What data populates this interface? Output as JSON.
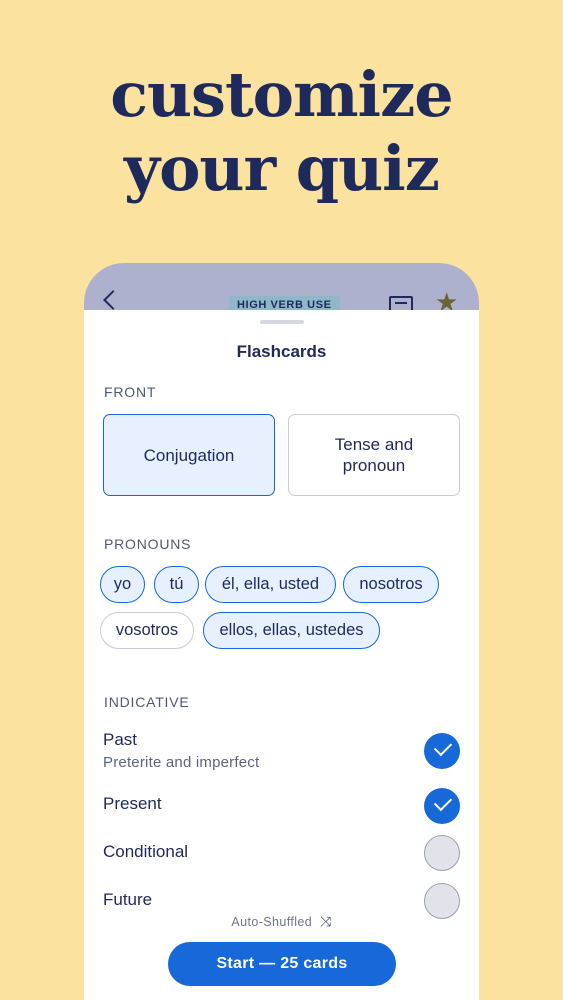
{
  "headline": {
    "line1": "customize",
    "line2": "your quiz"
  },
  "topbar": {
    "tag": "HIGH VERB USE",
    "star_glyph": "★"
  },
  "sheet": {
    "title": "Flashcards",
    "front": {
      "label": "FRONT",
      "options": [
        {
          "label": "Conjugation",
          "selected": true
        },
        {
          "label": "Tense and pronoun",
          "selected": false
        }
      ]
    },
    "pronouns": {
      "label": "PRONOUNS",
      "chips": [
        {
          "label": "yo",
          "selected": true
        },
        {
          "label": "tú",
          "selected": true
        },
        {
          "label": "él, ella, usted",
          "selected": true
        },
        {
          "label": "nosotros",
          "selected": true
        },
        {
          "label": "vosotros",
          "selected": false
        },
        {
          "label": "ellos, ellas, ustedes",
          "selected": true
        }
      ]
    },
    "indicative": {
      "label": "INDICATIVE",
      "rows": [
        {
          "title": "Past",
          "subtitle": "Preterite and imperfect",
          "checked": true
        },
        {
          "title": "Present",
          "subtitle": "",
          "checked": true
        },
        {
          "title": "Conditional",
          "subtitle": "",
          "checked": false
        },
        {
          "title": "Future",
          "subtitle": "",
          "checked": false
        }
      ]
    },
    "shuffle_label": "Auto-Shuffled",
    "start_label": "Start — 25 cards"
  },
  "colors": {
    "background": "#fbe29f",
    "accent": "#1769d9",
    "navy": "#1f2a5c"
  }
}
